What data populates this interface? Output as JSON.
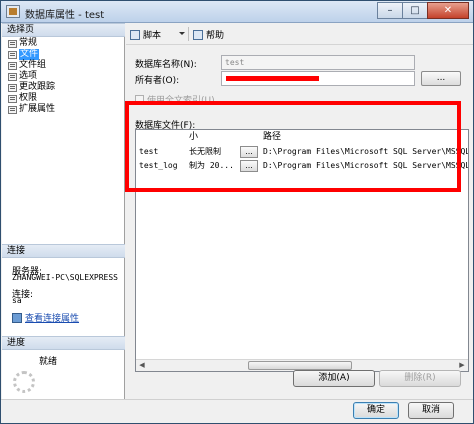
{
  "window": {
    "title": "数据库属性 - test",
    "buttons": {
      "minimize": "–",
      "maximize": "□",
      "close": "✕"
    }
  },
  "left_pane": {
    "select_page_header": "选择页",
    "pages": [
      {
        "label": "常规",
        "selected": false
      },
      {
        "label": "文件",
        "selected": true
      },
      {
        "label": "文件组",
        "selected": false
      },
      {
        "label": "选项",
        "selected": false
      },
      {
        "label": "更改跟踪",
        "selected": false
      },
      {
        "label": "权限",
        "selected": false
      },
      {
        "label": "扩展属性",
        "selected": false
      }
    ],
    "connection_header": "连接",
    "server_label": "服务器:",
    "server_value": "ZHANGWEI-PC\\SQLEXPRESS",
    "connection_label": "连接:",
    "connection_value": "sa",
    "view_connection_link": "查看连接属性",
    "progress_header": "进度",
    "progress_status": "就绪"
  },
  "toolbar": {
    "script_label": "脚本",
    "help_label": "帮助"
  },
  "form": {
    "db_name_label": "数据库名称(N):",
    "db_name_value": "test",
    "owner_label": "所有者(O):",
    "owner_browse": "...",
    "fulltext_label": "使用全文索引(U)",
    "files_label": "数据库文件(F):"
  },
  "files_grid": {
    "columns": [
      "",
      "小",
      "",
      "路径"
    ],
    "rows": [
      {
        "name": "test",
        "growth": "长无限制",
        "path": "D:\\Program Files\\Microsoft SQL Server\\MSSQL11.SQ"
      },
      {
        "name": "test_log",
        "growth": "制为 20...",
        "path": "D:\\Program Files\\Microsoft SQL Server\\MSSQL11.SQ"
      }
    ],
    "cell_button": "..."
  },
  "actions": {
    "add_label": "添加(A)",
    "remove_label": "删除(R)"
  },
  "dialog_buttons": {
    "ok_label": "确定",
    "cancel_label": "取消"
  },
  "colors": {
    "selection": "#3399ff",
    "highlight_box": "#ff0000",
    "link": "#1a4cb0"
  }
}
